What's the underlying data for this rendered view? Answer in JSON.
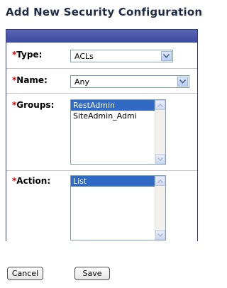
{
  "page": {
    "title": "Add New Security Configuration"
  },
  "form": {
    "type": {
      "label": "Type:",
      "value": "ACLs"
    },
    "name": {
      "label": "Name:",
      "value": "Any"
    },
    "groups": {
      "label": "Groups:",
      "options": [
        "RestAdmin",
        "SiteAdmin_Admi"
      ],
      "selected": "RestAdmin"
    },
    "action": {
      "label": "Action:",
      "options": [
        "List"
      ],
      "selected": "List"
    },
    "required_mark": "*"
  },
  "buttons": {
    "cancel": "Cancel",
    "save": "Save"
  },
  "colors": {
    "header_bar": "#3b4aa0",
    "selected_option": "#316ac5",
    "required": "#d00000"
  }
}
